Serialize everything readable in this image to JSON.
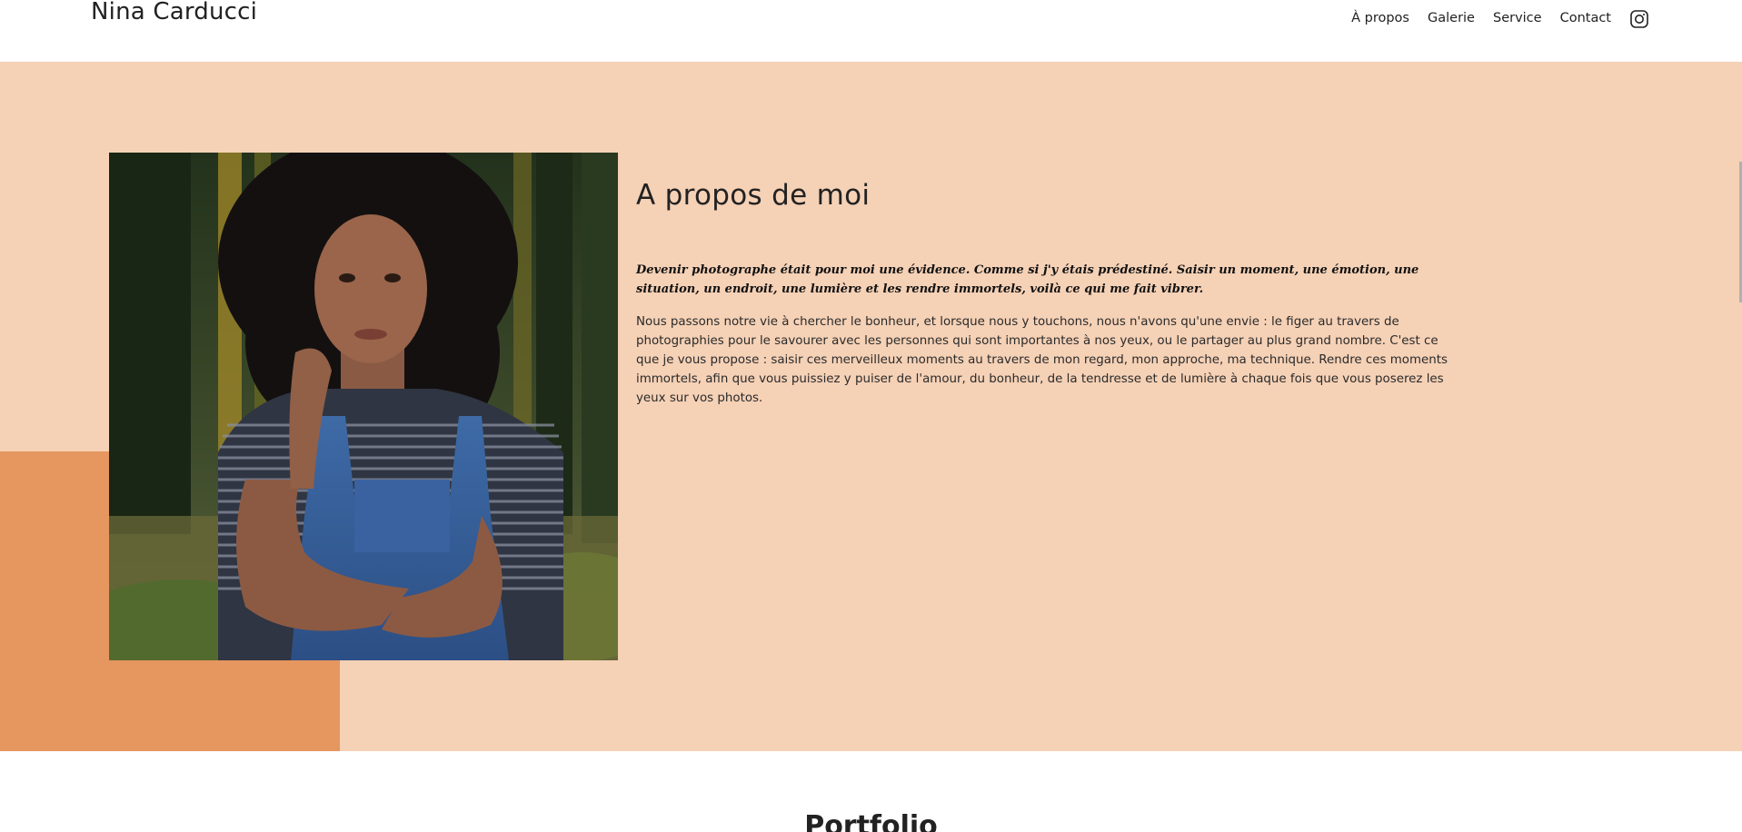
{
  "header": {
    "brand": "Nina Carducci",
    "nav": [
      "À propos",
      "Galerie",
      "Service",
      "Contact"
    ],
    "instagram_icon": "instagram-icon"
  },
  "about": {
    "title": "A propos de moi",
    "lead": "Devenir photographe était pour moi une évidence. Comme si j'y étais prédestiné. Saisir un moment, une émotion, une situation, un endroit, une lumière et les rendre immortels, voilà ce qui me fait vibrer.",
    "body": "Nous passons notre vie à chercher le bonheur, et lorsque nous y touchons, nous n'avons qu'une envie : le figer au travers de photographies pour le savourer avec les personnes qui sont importantes à nos yeux, ou le partager au plus grand nombre. C'est ce que je vous propose : saisir ces merveilleux moments au travers de mon regard, mon approche, ma technique. Rendre ces moments immortels, afin que vous puissiez y puiser de l'amour, du bonheur, de la tendresse et de lumière à chaque fois que vous poserez les yeux sur vos photos.",
    "colors": {
      "background": "#f5d1b6",
      "accent": "#e6965f"
    }
  },
  "portfolio": {
    "title": "Portfolio"
  }
}
